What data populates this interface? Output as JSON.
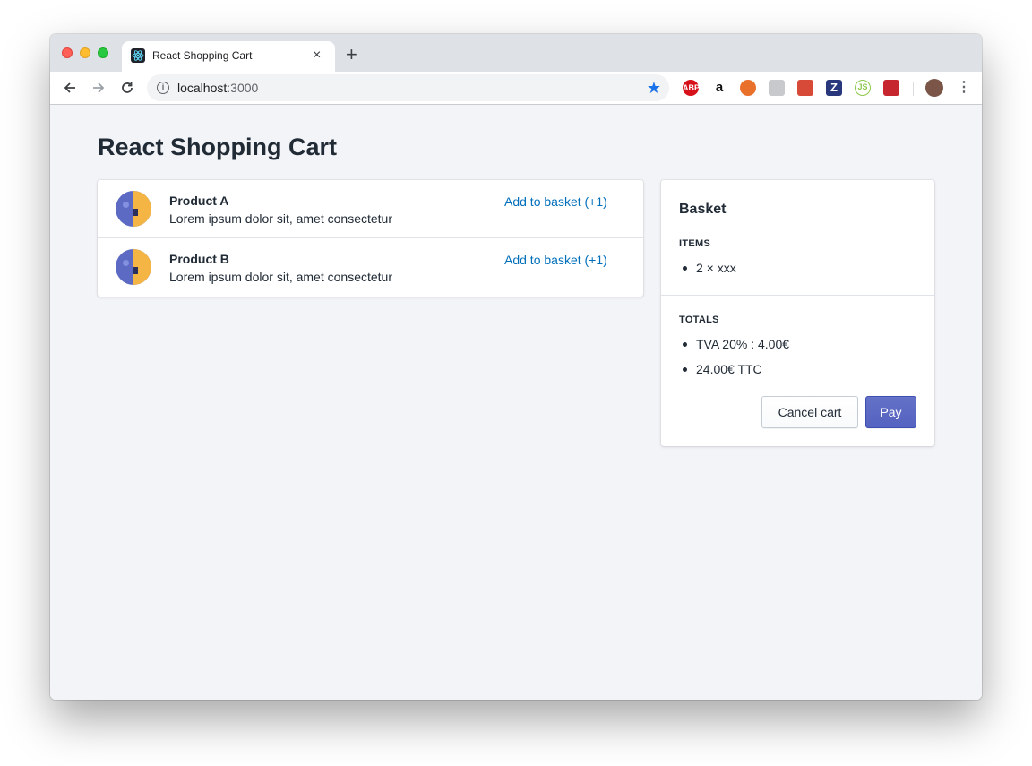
{
  "browser": {
    "tab_title": "React Shopping Cart",
    "tab_close": "×",
    "new_tab": "+",
    "url_host": "localhost",
    "url_port": ":3000",
    "back_icon": "arrow-left",
    "forward_icon": "arrow-right",
    "reload_icon": "reload",
    "extensions": [
      {
        "label": "ABP",
        "color": "#d7111a"
      },
      {
        "label": "a",
        "color": "#ffffff"
      },
      {
        "label": "",
        "color": "#e8702a"
      },
      {
        "label": "",
        "color": "#c7c9cc"
      },
      {
        "label": "",
        "color": "#d84a38"
      },
      {
        "label": "Z",
        "color": "#29387d"
      },
      {
        "label": "JS",
        "color": "#8cc84b"
      },
      {
        "label": "",
        "color": "#c6262e"
      }
    ],
    "accent": "#1a73e8"
  },
  "page": {
    "title": "React Shopping Cart"
  },
  "products": [
    {
      "name": "Product A",
      "description": "Lorem ipsum dolor sit, amet consectetur",
      "action": "Add to basket (+1)"
    },
    {
      "name": "Product B",
      "description": "Lorem ipsum dolor sit, amet consectetur",
      "action": "Add to basket (+1)"
    }
  ],
  "basket": {
    "title": "Basket",
    "items_label": "ITEMS",
    "items": [
      "2 × xxx"
    ],
    "totals_label": "TOTALS",
    "totals": [
      "TVA 20% : 4.00€",
      "24.00€ TTC"
    ],
    "cancel_label": "Cancel cart",
    "pay_label": "Pay",
    "pay_color": "#5c6ac4"
  }
}
